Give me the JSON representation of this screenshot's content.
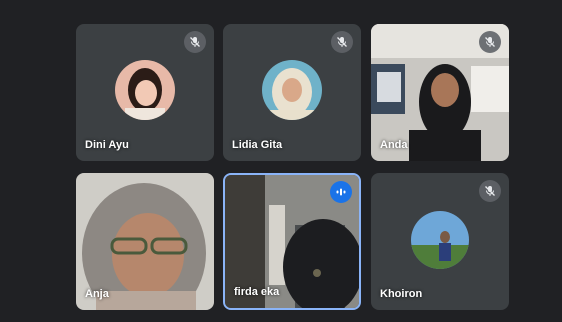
{
  "participants": [
    {
      "name": "Dini Ayu",
      "mic": "mic-off-icon"
    },
    {
      "name": "Lidia Gita",
      "mic": "mic-off-icon"
    },
    {
      "name": "Anda",
      "mic": "mic-off-icon"
    },
    {
      "name": "Anja",
      "mic": "none"
    },
    {
      "name": "firda eka",
      "mic": "speaking-icon",
      "active_speaker": true
    },
    {
      "name": "Khoiron",
      "mic": "mic-off-icon"
    }
  ],
  "colors": {
    "background": "#202124",
    "tile": "#3c4043",
    "active_border": "#8ab4f8",
    "speaking_badge": "#1a73e8"
  }
}
